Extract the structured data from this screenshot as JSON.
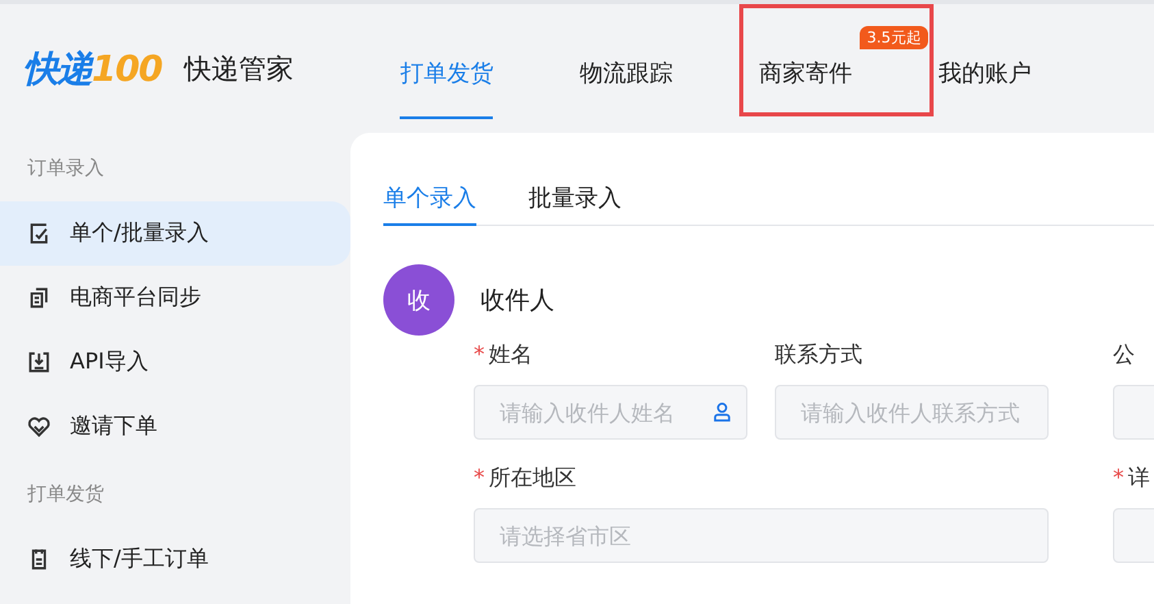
{
  "header": {
    "logo": {
      "text": "快递",
      "number": "100"
    },
    "product_name": "快递管家",
    "nav": [
      {
        "label": "打单发货",
        "selected": true,
        "highlighted": false
      },
      {
        "label": "物流跟踪",
        "selected": false,
        "highlighted": false
      },
      {
        "label": "商家寄件",
        "selected": false,
        "highlighted": true,
        "badge": "3.5元起"
      },
      {
        "label": "我的账户",
        "selected": false,
        "highlighted": false
      }
    ]
  },
  "sidebar": {
    "sections": [
      {
        "title": "订单录入",
        "items": [
          {
            "label": "单个/批量录入",
            "selected": true
          },
          {
            "label": "电商平台同步",
            "selected": false
          },
          {
            "label": "API导入",
            "selected": false
          },
          {
            "label": "邀请下单",
            "selected": false
          }
        ]
      },
      {
        "title": "打单发货",
        "items": [
          {
            "label": "线下/手工订单",
            "selected": false
          }
        ]
      }
    ]
  },
  "tabs": [
    {
      "label": "单个录入",
      "selected": true
    },
    {
      "label": "批量录入",
      "selected": false
    }
  ],
  "recipient": {
    "avatar": "收",
    "title": "收件人",
    "fields": [
      {
        "mark": "*",
        "label": "姓名",
        "placeholder": "请输入收件人姓名",
        "person_icon": true
      },
      {
        "label": "联系方式",
        "placeholder": "请输入收件人联系方式",
        "person_icon": false
      },
      {
        "label": "公"
      },
      {
        "mark": "*",
        "label": "所在地区",
        "placeholder": "请选择省市区",
        "person_icon": false
      },
      {
        "mark": "*",
        "label": "详"
      }
    ]
  }
}
